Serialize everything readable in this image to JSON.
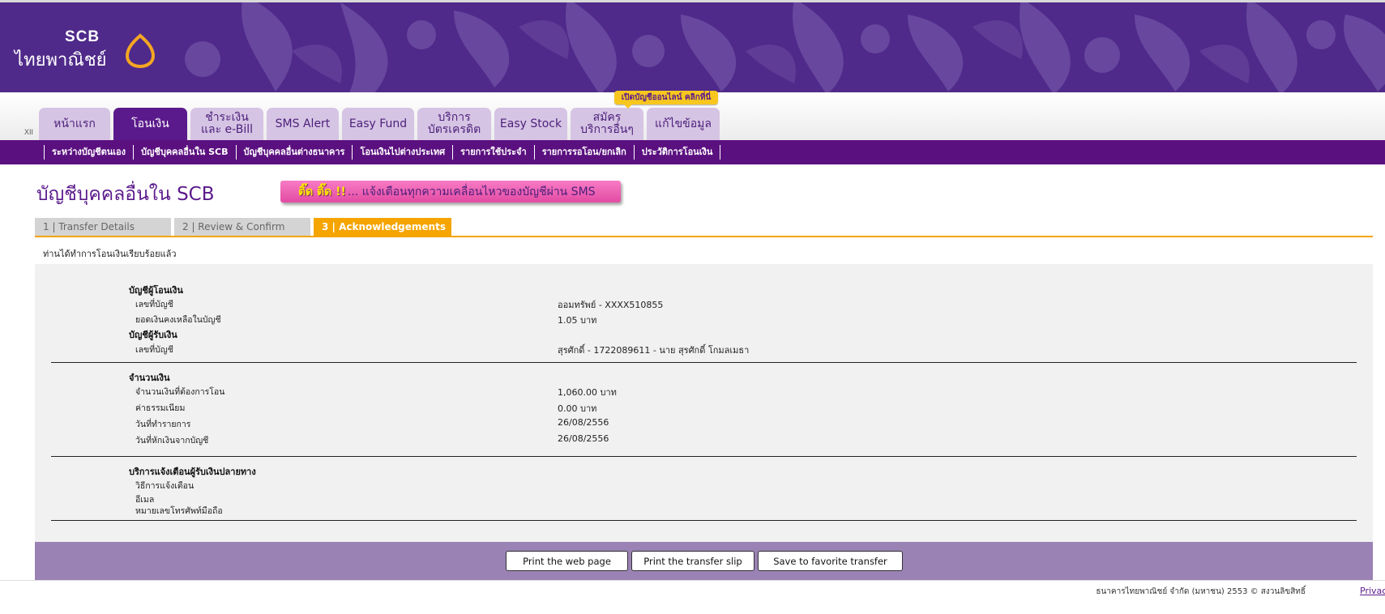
{
  "colors": {
    "brand_purple": "#4f2a8a",
    "nav_purple": "#5b1080",
    "tab_light": "#d6c4e4",
    "step_active": "#f5a400",
    "pink_banner": "#e34ba3",
    "action_bar": "#9a82b4",
    "logo_gold": "#f5a623"
  },
  "logo": {
    "brand": "SCB",
    "thai_name": "ไทยพาณิชย์",
    "icon": "scb-lotus-logo"
  },
  "promo": "เปิดบัญชีออนไลน์ คลิกที่นี่",
  "xii": "XII",
  "tabs": [
    {
      "label": "หน้าแรก",
      "active": false
    },
    {
      "label": "โอนเงิน",
      "active": true
    },
    {
      "label": "ชำระเงิน\nและ e-Bill",
      "active": false
    },
    {
      "label": "SMS Alert",
      "active": false
    },
    {
      "label": "Easy Fund",
      "active": false
    },
    {
      "label": "บริการ\nบัตรเครดิต",
      "active": false
    },
    {
      "label": "Easy Stock",
      "active": false
    },
    {
      "label": "สมัคร\nบริการอื่นๆ",
      "active": false
    },
    {
      "label": "แก้ไขข้อมูล",
      "active": false
    }
  ],
  "subnav": [
    "ระหว่างบัญชีตนเอง",
    "บัญชีบุคคลอื่นใน SCB",
    "บัญชีบุคคลอื่นต่างธนาคาร",
    "โอนเงินไปต่างประเทศ",
    "รายการใช้ประจำ",
    "รายการรอโอน/ยกเลิก",
    "ประวัติการโอนเงิน"
  ],
  "page_title": "บัญชีบุคคลอื่นใน SCB",
  "sms_banner": {
    "ting": "ติ๊ด ติ๊ด !!",
    "text": "... แจ้งเตือนทุกความเคลื่อนไหวของบัญชีผ่าน SMS"
  },
  "steps": [
    "1 | Transfer Details",
    "2 | Review & Confirm",
    "3 | Acknowledgements"
  ],
  "success_message": "ท่านได้ทำการโอนเงินเรียบร้อยแล้ว",
  "details": {
    "from_heading": "บัญชีผู้โอนเงิน",
    "from_account_label": "เลขที่บัญชี",
    "from_account_value": "ออมทรัพย์ - XXXX510855",
    "balance_label": "ยอดเงินคงเหลือในบัญชี",
    "balance_value": "1.05 บาท",
    "to_heading": "บัญชีผู้รับเงิน",
    "to_account_label": "เลขที่บัญชี",
    "to_account_value": "สุรศักดิ์ - 1722089611 - นาย สุรศักดิ์ โกมลเมธา",
    "amount_heading": "จำนวนเงิน",
    "amount_label": "จำนวนเงินที่ต้องการโอน",
    "amount_value": "1,060.00 บาท",
    "fee_label": "ค่าธรรมเนียม",
    "fee_value": "0.00  บาท",
    "txn_date_label": "วันที่ทำรายการ",
    "txn_date_value": "26/08/2556",
    "debit_date_label": "วันที่หักเงินจากบัญชี",
    "debit_date_value": "26/08/2556",
    "notify_heading": "บริการแจ้งเตือนผู้รับเงินปลายทาง",
    "notify_method_label": "วิธีการแจ้งเตือน",
    "email_label": "อีเมล",
    "mobile_label": "หมายเลขโทรศัพท์มือถือ"
  },
  "buttons": {
    "print_page": "Print the web page",
    "print_slip": "Print the transfer slip",
    "save_fav": "Save to favorite transfer"
  },
  "footer": {
    "copyright": "ธนาคารไทยพาณิชย์ จำกัด (มหาชน) 2553 © สงวนลิขสิทธิ์",
    "privacy": "Privac"
  }
}
